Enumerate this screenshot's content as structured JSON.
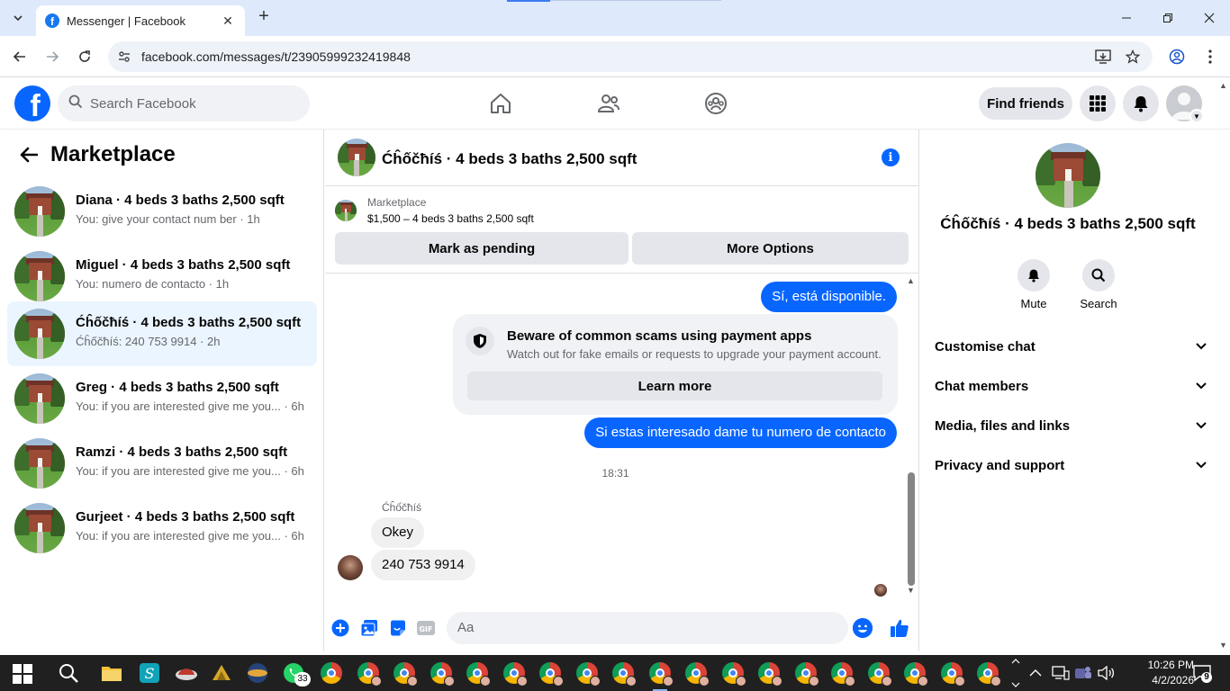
{
  "browser": {
    "tab_title": "Messenger | Facebook",
    "url": "facebook.com/messages/t/23905999232419848"
  },
  "header": {
    "search_placeholder": "Search Facebook",
    "find_friends": "Find friends"
  },
  "sidebar": {
    "title": "Marketplace",
    "conversations": [
      {
        "name": "Diana · 4 beds 3 baths 2,500 sqft",
        "snippet": "You: give your contact num ber · 1h",
        "active": false
      },
      {
        "name": "Miguel · 4 beds 3 baths 2,500 sqft",
        "snippet": "You: numero de contacto · 1h",
        "active": false
      },
      {
        "name": "Ćĥốčħíś · 4 beds 3 baths 2,500 sqft",
        "snippet": "Ćĥốčħíś: 240 753 9914 · 2h",
        "active": true
      },
      {
        "name": "Greg · 4 beds 3 baths 2,500 sqft",
        "snippet": "You: if you are interested give me you... · 6h",
        "active": false
      },
      {
        "name": "Ramzi · 4 beds 3 baths 2,500 sqft",
        "snippet": "You: if you are interested give me you... · 6h",
        "active": false
      },
      {
        "name": "Gurjeet · 4 beds 3 baths 2,500 sqft",
        "snippet": "You: if you are interested give me you... · 6h",
        "active": false
      }
    ]
  },
  "chat": {
    "title": "Ćĥốčħíś · 4 beds 3 baths 2,500 sqft",
    "listing": {
      "label": "Marketplace",
      "price_line": "$1,500 – 4 beds 3 baths 2,500 sqft",
      "mark_pending": "Mark as pending",
      "more_options": "More Options"
    },
    "messages": {
      "out1": "Sí, está disponible.",
      "scam_title": "Beware of common scams using payment apps",
      "scam_desc": "Watch out for fake emails or requests to upgrade your payment account.",
      "learn_more": "Learn more",
      "out2": "Si estas interesado dame tu numero de contacto",
      "time": "18:31",
      "sender": "Ćĥốčħíś",
      "in1": "Okey",
      "in2": "240 753 9914"
    },
    "composer_placeholder": "Aa"
  },
  "details": {
    "title": "Ćĥốčħíś · 4 beds 3 baths 2,500 sqft",
    "mute": "Mute",
    "search": "Search",
    "sections": [
      "Customise chat",
      "Chat members",
      "Media, files and links",
      "Privacy and support"
    ]
  },
  "taskbar": {
    "whatsapp_badge": "33",
    "time": "10:26 PM",
    "date": "4/2/2026",
    "notification_count": "9"
  },
  "colors": {
    "accent": "#0866ff",
    "active_row": "#ebf5ff",
    "tabstrip": "#dee9fb",
    "taskbar": "#202020"
  }
}
